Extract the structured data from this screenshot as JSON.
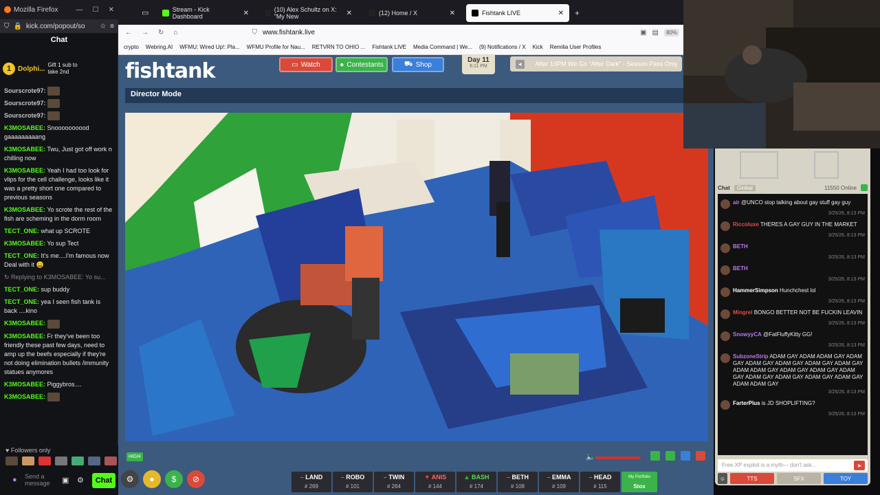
{
  "left_window": {
    "title": "Mozilla Firefox",
    "url": "kick.com/popout/so",
    "chat_label": "Chat",
    "pinned": {
      "coin": "1",
      "user": "Dolphi...",
      "gift_text": "Gift 1 sub to take 2nd"
    },
    "messages": [
      {
        "user": "Sourscrote97:",
        "text": "",
        "color": "#c4c4c4"
      },
      {
        "user": "Sourscrote97:",
        "text": "",
        "color": "#c4c4c4"
      },
      {
        "user": "Sourscrote97:",
        "text": "",
        "color": "#c4c4c4"
      },
      {
        "user": "K3MOSABEE:",
        "text": "Snoooooooood gaaaaaaaaang",
        "color": "#53fc18"
      },
      {
        "user": "K3MOSABEE:",
        "text": "Twu, Just got off work n chilling now",
        "color": "#53fc18"
      },
      {
        "user": "K3MOSABEE:",
        "text": "Yeah I had too look for vlips for the cell challenge, looks like it was a pretty short one compared to previous seasons",
        "color": "#53fc18"
      },
      {
        "user": "K3MOSABEE:",
        "text": "Yo scrote the rest of the fish are scheming in the dorm room",
        "color": "#53fc18"
      },
      {
        "user": "TECT_ONE:",
        "text": "what up SCROTE",
        "color": "#53fc18"
      },
      {
        "user": "K3MOSABEE:",
        "text": "Yo sup Tect",
        "color": "#53fc18"
      },
      {
        "user": "TECT_ONE:",
        "text": "It's me....I'm famous now Deal with it 😄",
        "color": "#53fc18"
      },
      {
        "user": "",
        "text": "↻ Replying to K3MOSABEE: Yo su...",
        "color": "#888"
      },
      {
        "user": "TECT_ONE:",
        "text": "sup buddy",
        "color": "#53fc18"
      },
      {
        "user": "TECT_ONE:",
        "text": "yea I seen fish tank is back ....kino",
        "color": "#53fc18"
      },
      {
        "user": "K3MOSABEE:",
        "text": "",
        "color": "#53fc18"
      },
      {
        "user": "K3MOSABEE:",
        "text": "Fr they've been too friendly these past few days, need to amp up the beefs especially if they're not doing elimination bullets /immunity statues anymores",
        "color": "#53fc18"
      },
      {
        "user": "K3MOSABEE:",
        "text": "Piggybros....",
        "color": "#53fc18"
      },
      {
        "user": "K3MOSABEE:",
        "text": "",
        "color": "#53fc18"
      }
    ],
    "followers_only": "♥ Followers only",
    "send_placeholder": "Send a message",
    "chat_button": "Chat"
  },
  "tabs": [
    {
      "label": "Stream - Kick Dashboard",
      "active": false
    },
    {
      "label": "(10) Alex Schultz on X: \"My New",
      "active": false
    },
    {
      "label": "(12) Home / X",
      "active": false
    },
    {
      "label": "Fishtank LIVE",
      "active": true
    }
  ],
  "url": "www.fishtank.live",
  "zoom": "80%",
  "bookmarks": [
    "crypto",
    "Webring.AI",
    "WFMU: Wired Up!: Pla...",
    "WFMU Profile for Nau...",
    "RETVRN TO OHIO ...",
    "Fishtank LIVE",
    "Media Command | We...",
    "(9) Notifications / X",
    "Kick",
    "Remilia User Profiles"
  ],
  "site": {
    "logo": "fishtank",
    "buttons": [
      {
        "label": "Watch",
        "color": "#d94a3a"
      },
      {
        "label": "Contestants",
        "color": "#3bb34a"
      },
      {
        "label": "Shop",
        "color": "#3a7fd9"
      }
    ],
    "day": "Day 11",
    "time": "6:11 PM",
    "announcement": "After 10PM We Go \"After Dark\" - Season Pass Only",
    "director_mode": "Director Mode",
    "quality_badge": "HIGH",
    "contestants": [
      {
        "name": "LAND",
        "num": "# 269",
        "marker": ""
      },
      {
        "name": "ROBO",
        "num": "# 101",
        "marker": ""
      },
      {
        "name": "TWIN",
        "num": "# 264",
        "marker": ""
      },
      {
        "name": "ANIS",
        "num": "# 144",
        "marker": "down"
      },
      {
        "name": "BASH",
        "num": "# 174",
        "marker": "up"
      },
      {
        "name": "BETH",
        "num": "# 108",
        "marker": ""
      },
      {
        "name": "EMMA",
        "num": "# 109",
        "marker": ""
      },
      {
        "name": "HEAD",
        "num": "# 115",
        "marker": ""
      }
    ],
    "portfolio": {
      "label": "My Portfolio",
      "value": "Stox"
    }
  },
  "right_chat": {
    "tabs": [
      "Chat",
      "Global"
    ],
    "online": "11550 Online",
    "messages": [
      {
        "user": "air",
        "text": "@UNCO stop talking about gay stuff gay guy",
        "time": "3/25/26, 8:13 PM",
        "color": "#b47ce8"
      },
      {
        "user": "Riccoluxe",
        "text": "THERES A GAY GUY IN THE MARKET",
        "time": "3/25/26, 8:13 PM",
        "color": "#e84a4a"
      },
      {
        "user": "BETH",
        "text": "",
        "time": "3/25/26, 8:13 PM",
        "color": "#b47ce8"
      },
      {
        "user": "BETH",
        "text": "",
        "time": "3/25/26, 8:13 PM",
        "color": "#b47ce8"
      },
      {
        "user": "HammerSimpson",
        "text": "Hunchchest lol",
        "time": "3/25/26, 8:13 PM",
        "color": "#ffffff"
      },
      {
        "user": "Mingrel",
        "text": "BONGO BETTER NOT BE FUCKIN LEAVIN",
        "time": "3/25/26, 8:13 PM",
        "color": "#e84a4a"
      },
      {
        "user": "SnowyyCA",
        "text": "@FatFluffyKitty GG!",
        "time": "3/25/26, 8:13 PM",
        "color": "#b47ce8"
      },
      {
        "user": "SubzoneStrip",
        "text": "ADAM GAY ADAM ADAM GAY ADAM GAY ADAM GAY ADAM GAY ADAM GAY ADAM GAY ADAM ADAM GAY ADAM GAY ADAM GAY ADAM GAY ADAM GAY ADAM GAY ADAM GAY ADAM GAY ADAM ADAM GAY",
        "time": "3/25/26, 8:13 PM",
        "color": "#b47ce8"
      },
      {
        "user": "FarterPlus",
        "text": "is JD SHOPLIFTING?",
        "time": "3/25/26, 8:13 PM",
        "color": "#ffffff"
      }
    ],
    "input_placeholder": "Free XP exploit is a myth— don't ask...",
    "buttons": [
      "TTS",
      "SFX",
      "TOY"
    ]
  }
}
